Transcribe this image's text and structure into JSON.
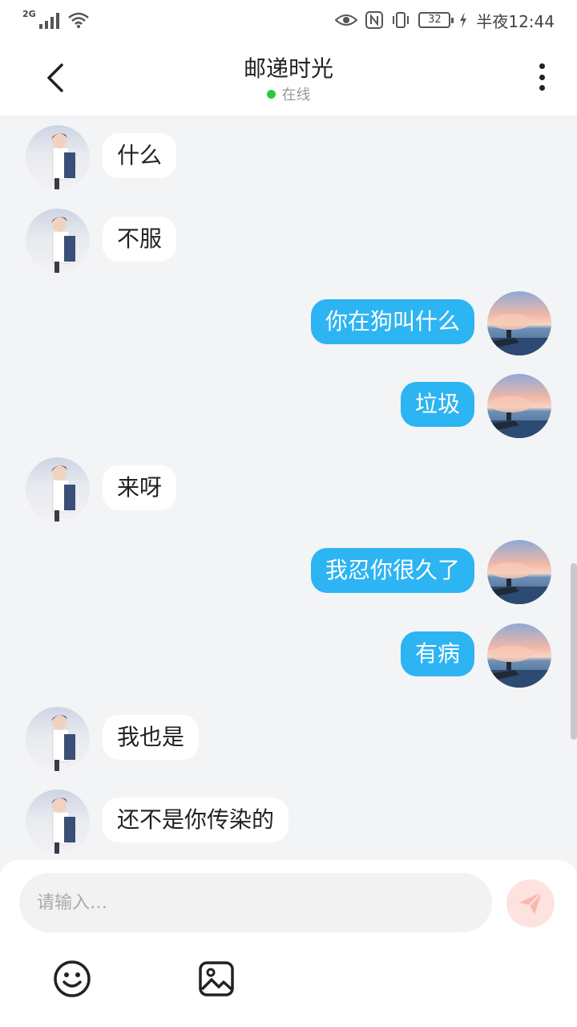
{
  "status_bar": {
    "network": "2G",
    "battery": "32",
    "time": "半夜12:44"
  },
  "header": {
    "title": "邮递时光",
    "presence": "在线"
  },
  "messages": [
    {
      "side": "left",
      "text": "什么"
    },
    {
      "side": "left",
      "text": "不服"
    },
    {
      "side": "right",
      "text": "你在狗叫什么"
    },
    {
      "side": "right",
      "text": "垃圾"
    },
    {
      "side": "left",
      "text": "来呀"
    },
    {
      "side": "right",
      "text": "我忍你很久了"
    },
    {
      "side": "right",
      "text": "有病"
    },
    {
      "side": "left",
      "text": "我也是"
    },
    {
      "side": "left",
      "text": "还不是你传染的"
    }
  ],
  "composer": {
    "placeholder": "请输入…",
    "value": ""
  },
  "icons": {
    "back": "chevron-left-icon",
    "more": "more-vertical-icon",
    "send": "paper-plane-icon",
    "emoji": "smiley-icon",
    "image": "image-icon"
  },
  "colors": {
    "outgoing_bubble": "#2db4f2",
    "incoming_bubble": "#ffffff",
    "online_dot": "#2ec840",
    "send_button": "#fde2df",
    "background": "#f3f4f6"
  }
}
